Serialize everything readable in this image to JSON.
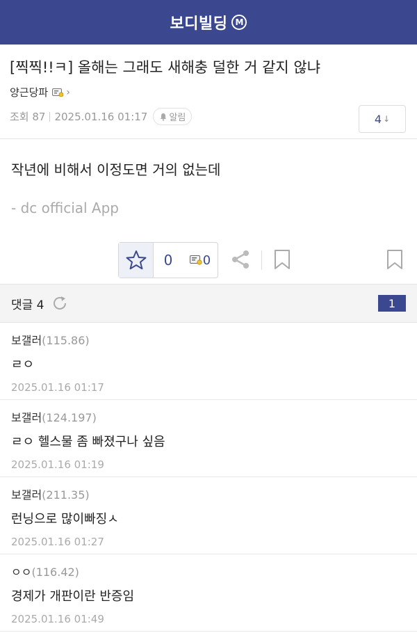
{
  "header": {
    "title": "보디빌딩",
    "badge": "M"
  },
  "post": {
    "title": "[찍찍!!ㅋ] 올해는 그래도 새해충 덜한 거 같지 않냐",
    "author": "양근당파",
    "views_label": "조회 87",
    "datetime": "2025.01.16 01:17",
    "alarm_label": "알림",
    "comment_jump": "4",
    "comment_jump_arrow": "↓",
    "body_text": "작년에 비해서 이정도면 거의 없는데",
    "signature": "- dc official App",
    "recommend_count": "0",
    "fixed_recommend_count": "0"
  },
  "comments_header": {
    "label": "댓글 4",
    "page": "1"
  },
  "comments": [
    {
      "nick": "보갤러",
      "ip": "(115.86)",
      "text": "ㄹㅇ",
      "date": "2025.01.16 01:17"
    },
    {
      "nick": "보갤러",
      "ip": "(124.197)",
      "text": "ㄹㅇ 헬스물 좀 빠졌구나 싶음",
      "date": "2025.01.16 01:19"
    },
    {
      "nick": "보갤러",
      "ip": "(211.35)",
      "text": "런닝으로 많이빠징ㅅ",
      "date": "2025.01.16 01:27"
    },
    {
      "nick": "ㅇㅇ",
      "ip": "(116.42)",
      "text": "경제가 개판이란 반증임",
      "date": "2025.01.16 01:49"
    }
  ],
  "colors": {
    "brand": "#3b4890",
    "muted": "#999999"
  },
  "icons": [
    "m-badge-icon",
    "gallog-icon",
    "chevron-right-icon",
    "bell-icon",
    "star-icon",
    "gallog-fix-icon",
    "share-icon",
    "bookmark-icon",
    "scrap-icon",
    "refresh-icon"
  ]
}
